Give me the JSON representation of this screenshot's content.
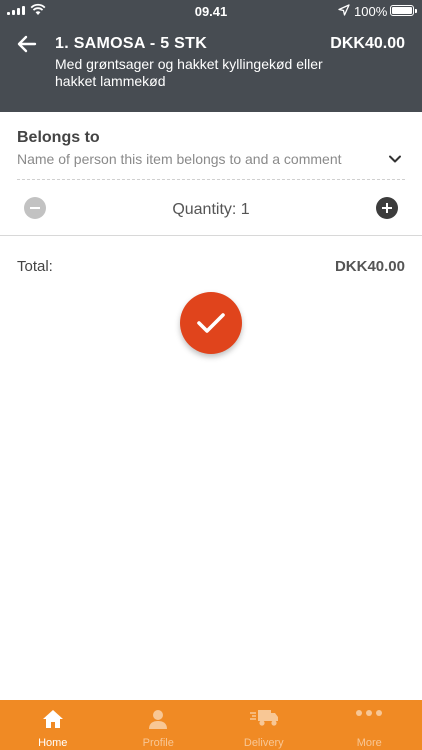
{
  "status_bar": {
    "time": "09.41",
    "battery": "100%"
  },
  "header": {
    "title": "1. SAMOSA - 5 STK",
    "price": "DKK40.00",
    "description": "Med grøntsager og hakket kyllingekød eller hakket lammekød"
  },
  "belongs": {
    "title": "Belongs to",
    "placeholder": "Name of person this item belongs to and a comment"
  },
  "quantity": {
    "label": "Quantity: 1",
    "value": 1
  },
  "total": {
    "label": "Total:",
    "value": "DKK40.00"
  },
  "colors": {
    "header_bg": "#474c52",
    "accent": "#e0441c",
    "tabbar_bg": "#f08a24"
  },
  "tabbar": {
    "items": [
      {
        "label": "Home",
        "icon": "home-icon",
        "active": true
      },
      {
        "label": "Profile",
        "icon": "profile-icon",
        "active": false
      },
      {
        "label": "Delivery",
        "icon": "truck-icon",
        "active": false
      },
      {
        "label": "More",
        "icon": "more-icon",
        "active": false
      }
    ]
  }
}
